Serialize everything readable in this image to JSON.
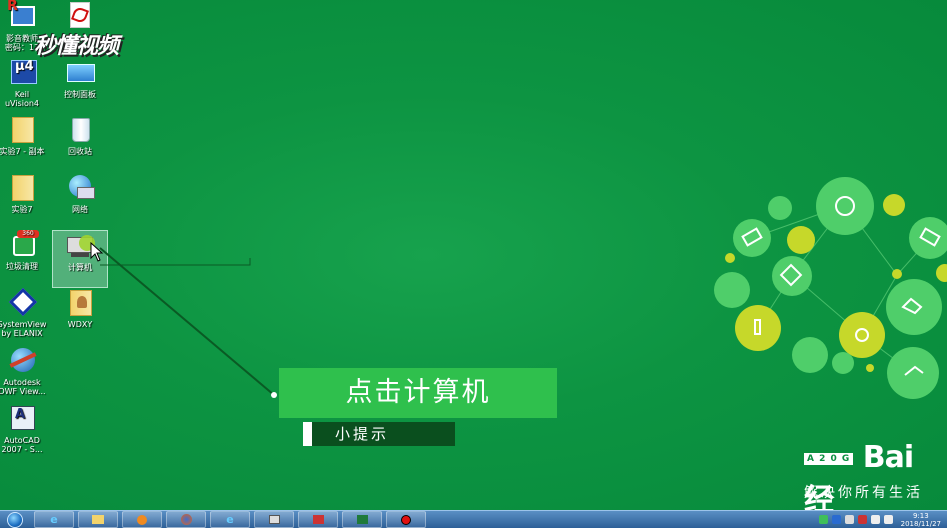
{
  "desktop_icons": [
    {
      "id": "yingyin",
      "label": "影音教师\n密码：12",
      "icon": "media-app-icon"
    },
    {
      "id": "adobe",
      "label": "Adobe",
      "icon": "pdf-icon"
    },
    {
      "id": "keil",
      "label": "Keil\nuVision4",
      "icon": "keil-icon"
    },
    {
      "id": "control-panel",
      "label": "控制面板",
      "icon": "control-panel-icon"
    },
    {
      "id": "shiyan7-copy",
      "label": "实验7 - 副本",
      "icon": "folder-icon"
    },
    {
      "id": "recycle-bin",
      "label": "回收站",
      "icon": "recycle-bin-icon"
    },
    {
      "id": "shiyan7",
      "label": "实验7",
      "icon": "folder-icon"
    },
    {
      "id": "network",
      "label": "网络",
      "icon": "network-icon"
    },
    {
      "id": "cleanup",
      "label": "垃圾清理",
      "icon": "cleanup-icon"
    },
    {
      "id": "computer",
      "label": "计算机",
      "icon": "computer-icon"
    },
    {
      "id": "systemview",
      "label": "SystemView\nby ELANIX",
      "icon": "systemview-icon"
    },
    {
      "id": "wdxy",
      "label": "WDXY",
      "icon": "folder-user-icon"
    },
    {
      "id": "autodesk-dwf",
      "label": "Autodesk\nDWF View...",
      "icon": "autodesk-icon"
    },
    {
      "id": "autocad",
      "label": "AutoCAD\n2007 - S...",
      "icon": "autocad-icon"
    }
  ],
  "watermark": "秒懂视频",
  "tip": {
    "main": "点击计算机",
    "sub": "小提示"
  },
  "baidu": {
    "logo": "Bai 经",
    "badge": "A 2 0 G",
    "slogan": "解决你所有生活"
  },
  "taskbar": {
    "buttons": [
      {
        "icon": "ie-icon"
      },
      {
        "icon": "explorer-icon"
      },
      {
        "icon": "media-player-icon"
      },
      {
        "icon": "firefox-icon"
      },
      {
        "icon": "ie2-icon"
      },
      {
        "icon": "app-icon"
      },
      {
        "icon": "chart-app-icon"
      },
      {
        "icon": "excel-icon"
      },
      {
        "icon": "record-icon"
      }
    ],
    "clock_time": "9:13",
    "clock_date": "2018/11/27"
  },
  "colors": {
    "desktop": "#0d9442",
    "tip_main": "#2fc04d",
    "tip_sub": "#0a4f1e",
    "taskbar": "#3b6ea8"
  }
}
